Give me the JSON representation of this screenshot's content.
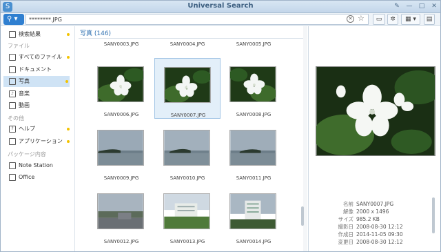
{
  "window": {
    "title": "Universal Search"
  },
  "toolbar": {
    "search_value": "********.JPG",
    "search_button_icon": "magnifier-icon",
    "buttons": [
      "folder-icon",
      "gear-icon",
      "grid-view-icon",
      "panel-icon"
    ]
  },
  "sidebar": {
    "items": [
      {
        "label": "検索結果",
        "icon": "monitor-icon",
        "dot": true
      },
      {
        "label": "すべてのファイル",
        "icon": "files-icon",
        "dot": true
      },
      {
        "label": "ドキュメント",
        "icon": "document-icon",
        "dot": false
      },
      {
        "label": "写真",
        "icon": "photo-icon",
        "dot": true,
        "active": true
      },
      {
        "label": "音楽",
        "icon": "music-icon",
        "dot": false
      },
      {
        "label": "動画",
        "icon": "video-icon",
        "dot": false
      },
      {
        "label": "ヘルプ",
        "icon": "help-icon",
        "dot": true
      },
      {
        "label": "アプリケーション",
        "icon": "apps-icon",
        "dot": true
      },
      {
        "label": "Note Station",
        "icon": "note-icon",
        "dot": false
      },
      {
        "label": "Office",
        "icon": "office-icon",
        "dot": false
      }
    ],
    "sections": [
      "ファイル",
      "その他",
      "パッケージ内容"
    ]
  },
  "main": {
    "header": "写真 (146)",
    "files": [
      "SANY0003.JPG",
      "SANY0004.JPG",
      "SANY0005.JPG",
      "SANY0006.JPG",
      "SANY0007.JPG",
      "SANY0008.JPG",
      "SANY0009.JPG",
      "SANY0010.JPG",
      "SANY0011.JPG",
      "SANY0012.JPG",
      "SANY0013.JPG",
      "SANY0014.JPG"
    ],
    "selected": "SANY0007.JPG"
  },
  "preview": {
    "meta": [
      {
        "k": "名前",
        "v": "SANY0007.JPG"
      },
      {
        "k": "解像",
        "v": "2000 x 1496"
      },
      {
        "k": "サイズ",
        "v": "985.2 KB"
      },
      {
        "k": "撮影日",
        "v": "2008-08-30 12:12"
      },
      {
        "k": "作成日",
        "v": "2014-11-05 09:30"
      },
      {
        "k": "変更日",
        "v": "2008-08-30 12:12"
      }
    ]
  }
}
